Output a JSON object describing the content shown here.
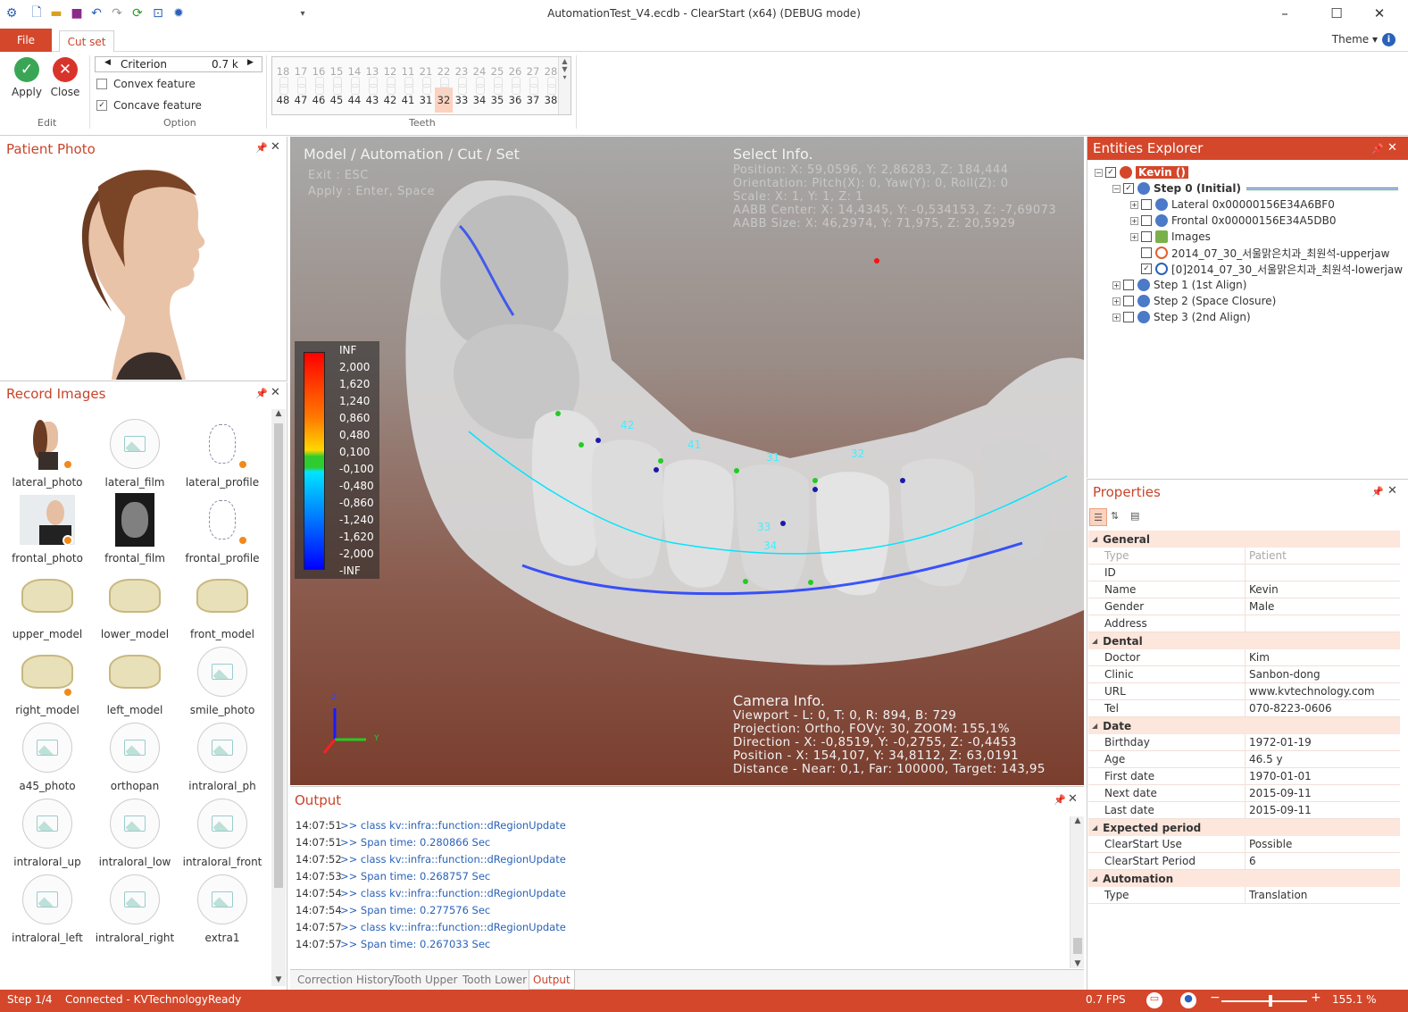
{
  "window": {
    "title": "AutomationTest_V4.ecdb - ClearStart (x64) (DEBUG mode)",
    "theme_label": "Theme"
  },
  "tabs": {
    "file": "File",
    "cut_set": "Cut set"
  },
  "ribbon": {
    "apply": "Apply",
    "close": "Close",
    "edit_group": "Edit",
    "criterion_label": "Criterion",
    "criterion_value": "0.7 k",
    "convex": "Convex feature",
    "concave": "Concave feature",
    "option_group": "Option",
    "teeth_group": "Teeth",
    "upper_teeth": [
      "18",
      "17",
      "16",
      "15",
      "14",
      "13",
      "12",
      "11",
      "21",
      "22",
      "23",
      "24",
      "25",
      "26",
      "27",
      "28"
    ],
    "lower_teeth": [
      "48",
      "47",
      "46",
      "45",
      "44",
      "43",
      "42",
      "41",
      "31",
      "32",
      "33",
      "34",
      "35",
      "36",
      "37",
      "38"
    ],
    "selected_tooth": "32"
  },
  "patient_photo": {
    "title": "Patient Photo"
  },
  "record_images": {
    "title": "Record Images",
    "items": [
      "lateral_photo",
      "lateral_film",
      "lateral_profile",
      "frontal_photo",
      "frontal_film",
      "frontal_profile",
      "upper_model",
      "lower_model",
      "front_model",
      "right_model",
      "left_model",
      "smile_photo",
      "a45_photo",
      "orthopan",
      "intraloral_ph",
      "intraloral_up",
      "intraloral_low",
      "intraloral_front",
      "intraloral_left",
      "intraloral_right",
      "extra1"
    ]
  },
  "viewport": {
    "breadcrumb": "Model / Automation / Cut / Set",
    "hint_exit": "Exit : ESC",
    "hint_apply": "Apply : Enter, Space",
    "select_title": "Select Info.",
    "select_lines": [
      "Position: X: 59,0596, Y: 2,86283, Z: 184,444",
      "Orientation: Pitch(X): 0, Yaw(Y): 0, Roll(Z): 0",
      "Scale: X: 1, Y: 1, Z: 1",
      "AABB Center: X: 14,4345, Y: -0,534153, Z: -7,69073",
      "AABB Size: X: 46,2974, Y: 71,975, Z: 20,5929"
    ],
    "camera_title": "Camera Info.",
    "camera_lines": [
      "Viewport - L: 0, T: 0, R: 894, B: 729",
      "Projection: Ortho, FOVy: 30, ZOOM: 155,1%",
      "Direction - X: -0,8519, Y: -0,2755, Z: -0,4453",
      "Position - X: 154,107, Y: 34,8112, Z: 63,0191",
      "Distance - Near: 0,1, Far: 100000, Target: 143,95"
    ],
    "legend": [
      "INF",
      "2,000",
      "1,620",
      "1,240",
      "0,860",
      "0,480",
      "0,100",
      "-0,100",
      "-0,480",
      "-0,860",
      "-1,240",
      "-1,620",
      "-2,000",
      "-INF"
    ],
    "tooth_labels": [
      "42",
      "41",
      "31",
      "32",
      "33",
      "34"
    ],
    "axis": {
      "z": "Z",
      "y": "Y"
    }
  },
  "output": {
    "title": "Output",
    "rows": [
      {
        "time": "14:07:51",
        "msg": ">> class kv::infra::function::dRegionUpdate"
      },
      {
        "time": "14:07:51",
        "msg": ">> Span time: 0.280866 Sec"
      },
      {
        "time": "14:07:52",
        "msg": ">> class kv::infra::function::dRegionUpdate"
      },
      {
        "time": "14:07:53",
        "msg": ">> Span time: 0.268757 Sec"
      },
      {
        "time": "14:07:54",
        "msg": ">> class kv::infra::function::dRegionUpdate"
      },
      {
        "time": "14:07:54",
        "msg": ">> Span time: 0.277576 Sec"
      },
      {
        "time": "14:07:57",
        "msg": ">> class kv::infra::function::dRegionUpdate"
      },
      {
        "time": "14:07:57",
        "msg": ">> Span time: 0.267033 Sec"
      }
    ],
    "tabs": [
      "Correction History",
      "Tooth Upper",
      "Tooth Lower",
      "Output"
    ]
  },
  "entities": {
    "title": "Entities Explorer",
    "root": "Kevin ()",
    "step0": "Step 0 (Initial)",
    "lateral": "Lateral 0x00000156E34A6BF0",
    "frontal": "Frontal 0x00000156E34A5DB0",
    "images": "Images",
    "upperjaw": "2014_07_30_서울맑은치과_최원석-upperjaw",
    "lowerjaw": "[0]2014_07_30_서울맑은치과_최원석-lowerjaw",
    "step1": "Step 1 (1st Align)",
    "step2": "Step 2 (Space Closure)",
    "step3": "Step 3 (2nd Align)"
  },
  "properties": {
    "title": "Properties",
    "groups": {
      "general": "General",
      "dental": "Dental",
      "date": "Date",
      "expected": "Expected period",
      "automation": "Automation"
    },
    "general": [
      [
        "Type",
        "Patient"
      ],
      [
        "ID",
        ""
      ],
      [
        "Name",
        "Kevin"
      ],
      [
        "Gender",
        "Male"
      ],
      [
        "Address",
        ""
      ]
    ],
    "dental": [
      [
        "Doctor",
        "Kim"
      ],
      [
        "Clinic",
        "Sanbon-dong"
      ],
      [
        "URL",
        "www.kvtechnology.com"
      ],
      [
        "Tel",
        "070-8223-0606"
      ]
    ],
    "date": [
      [
        "Birthday",
        "1972-01-19"
      ],
      [
        "Age",
        "46.5 y"
      ],
      [
        "First date",
        "1970-01-01"
      ],
      [
        "Next date",
        "2015-09-11"
      ],
      [
        "Last date",
        "2015-09-11"
      ]
    ],
    "expected": [
      [
        "ClearStart Use",
        "Possible"
      ],
      [
        "ClearStart Period",
        "6"
      ]
    ],
    "automation": [
      [
        "Type",
        "Translation"
      ]
    ]
  },
  "status": {
    "step": "Step 1/4",
    "connection": "Connected - KVTechnology",
    "state": "Ready",
    "fps": "0.7 FPS",
    "zoom": "155.1 %",
    "zoom_level": 0.55
  },
  "colors": {
    "accent": "#d4472b",
    "title_accent": "#c8442a",
    "link_blue": "#2a62b8"
  }
}
